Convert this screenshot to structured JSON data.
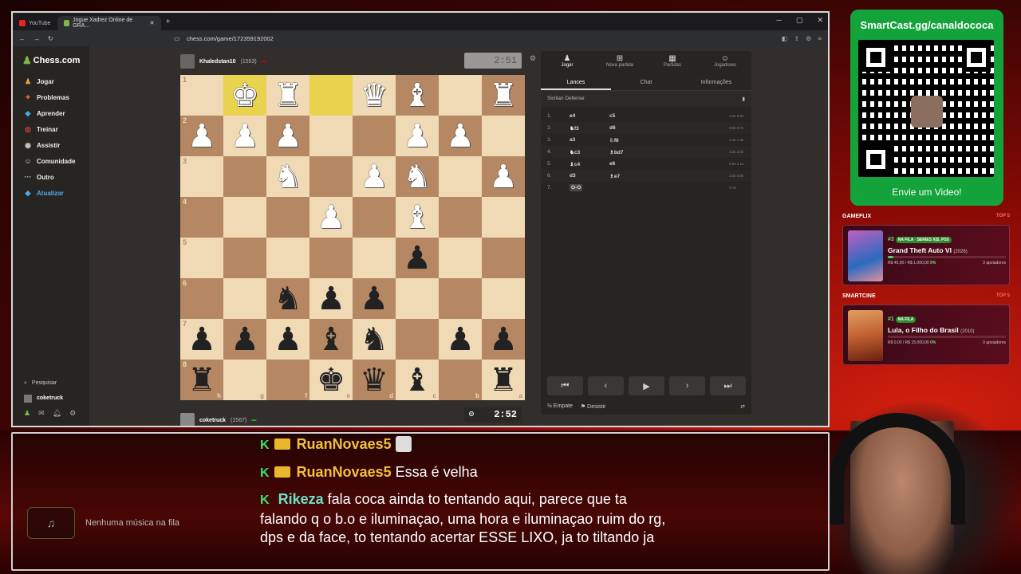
{
  "browser": {
    "tabs": [
      {
        "label": "YouTube"
      },
      {
        "label": "Jogue Xadrez Online de GRA..."
      }
    ],
    "url": "chess.com/game/172359192002"
  },
  "sidebar": {
    "logo": "Chess.com",
    "items": [
      {
        "label": "Jogar",
        "icon": "play-icon"
      },
      {
        "label": "Problemas",
        "icon": "puzzle-icon"
      },
      {
        "label": "Aprender",
        "icon": "learn-icon"
      },
      {
        "label": "Treinar",
        "icon": "train-icon"
      },
      {
        "label": "Assistir",
        "icon": "watch-icon"
      },
      {
        "label": "Comunidade",
        "icon": "community-icon"
      },
      {
        "label": "Outro",
        "icon": "more-icon"
      },
      {
        "label": "Atualizar",
        "icon": "diamond-icon"
      }
    ],
    "search": "Pesquisar",
    "user": "coketruck"
  },
  "game": {
    "top_player": {
      "name": "Khaledstan10",
      "rating": "(1553)"
    },
    "bottom_player": {
      "name": "coketruck",
      "rating": "(1567)"
    },
    "top_clock": "2:51",
    "bottom_clock": "2:52",
    "ranks": [
      "1",
      "2",
      "3",
      "4",
      "5",
      "6",
      "7",
      "8"
    ],
    "files": [
      "h",
      "g",
      "f",
      "e",
      "d",
      "c",
      "b",
      "a"
    ],
    "board": [
      [
        "",
        "wK",
        "wR",
        "",
        "wQ",
        "wB",
        "",
        "wR"
      ],
      [
        "wP",
        "wP",
        "wP",
        "",
        "",
        "wP",
        "wP",
        ""
      ],
      [
        "",
        "",
        "wN",
        "",
        "wP",
        "wN",
        "",
        "wP"
      ],
      [
        "",
        "",
        "",
        "wP",
        "",
        "wB",
        "",
        ""
      ],
      [
        "",
        "",
        "",
        "",
        "",
        "bP",
        "",
        ""
      ],
      [
        "",
        "",
        "bN",
        "bP",
        "bP",
        "",
        "",
        ""
      ],
      [
        "bP",
        "bP",
        "bP",
        "bB",
        "bN",
        "",
        "bP",
        "bP"
      ],
      [
        "bR",
        "",
        "",
        "bK",
        "bQ",
        "bB",
        "",
        "bR"
      ]
    ],
    "highlight": [
      [
        0,
        1
      ],
      [
        0,
        3
      ]
    ]
  },
  "panel": {
    "tabs": [
      {
        "label": "Jogar",
        "icon": "pawn-icon"
      },
      {
        "label": "Nova partida",
        "icon": "plus-icon"
      },
      {
        "label": "Partidas",
        "icon": "board-icon"
      },
      {
        "label": "Jogadores",
        "icon": "players-icon"
      }
    ],
    "subtabs": [
      "Lances",
      "Chat",
      "Informações"
    ],
    "opening": "Sicilian Defense",
    "moves": [
      {
        "n": "1.",
        "w": "e4",
        "b": "c5",
        "t": "1.2s 0.9s"
      },
      {
        "n": "2.",
        "w": "♞f3",
        "b": "d6",
        "t": "0.6s 0.7s"
      },
      {
        "n": "3.",
        "w": "a3",
        "b": "♘f6",
        "t": "1.4s 1.3s"
      },
      {
        "n": "4.",
        "w": "♞c3",
        "b": "♗bd7",
        "t": "3.2s 2.0s"
      },
      {
        "n": "5.",
        "w": "♝c4",
        "b": "e6",
        "t": "0.6s 1.1s"
      },
      {
        "n": "6.",
        "w": "d3",
        "b": "♗e7",
        "t": "2.0s 0.9s"
      },
      {
        "n": "7.",
        "w": "O-O",
        "b": "",
        "t": "0.7s"
      }
    ],
    "draw": "Empate",
    "resign": "Desistir"
  },
  "stream": {
    "smartcast": "SmartCast.gg/canaldococa",
    "send_video": "Envie um Video!",
    "gameflix": {
      "section": "GAMEFLIX",
      "top": "TOP 5",
      "rank": "#3",
      "tag": "NA FILA · SERIES X|S, PS5",
      "title": "Grand Theft Auto VI",
      "year": "(2026)",
      "raised": "R$ 45,00",
      "goal": "/ R$ 1.000,00",
      "pct": "5%",
      "progress": 0.05,
      "supporters": "3 apoiadores"
    },
    "smartcine": {
      "section": "SMARTCINE",
      "top": "TOP 5",
      "rank": "#1",
      "tag": "NA FILA",
      "title": "Lula, o Filho do Brasil",
      "year": "(2010)",
      "raised": "R$ 0,00",
      "goal": "/ R$ 15.000,00",
      "pct": "0%",
      "progress": 0.0,
      "supporters": "0 apoiadores"
    },
    "music": "Nenhuma música na fila",
    "chat": [
      {
        "user": "RuanNovaes5",
        "msg": ""
      },
      {
        "user": "RuanNovaes5",
        "msg": "Essa é velha"
      },
      {
        "user": "Rikeza",
        "msg": "fala coca ainda to tentando aqui, parece que ta falando q o b.o e iluminaçao, uma hora e iluminaçao ruim do rg, dps e da face, to tentando acertar ESSE LIXO, ja to tiltando ja"
      }
    ]
  }
}
